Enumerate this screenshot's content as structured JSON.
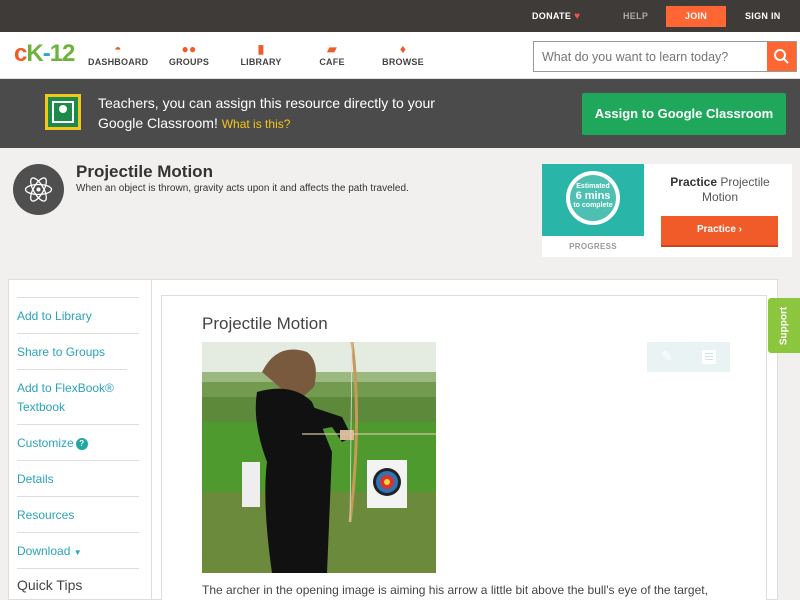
{
  "topbar": {
    "donate": "DONATE",
    "help": "HELP",
    "join": "JOIN",
    "signin": "SIGN IN"
  },
  "logo": {
    "c": "c",
    "k": "K",
    "dash": "-",
    "n": "12"
  },
  "nav": [
    {
      "label": "DASHBOARD",
      "icon": "dashboard-icon"
    },
    {
      "label": "GROUPS",
      "icon": "groups-icon"
    },
    {
      "label": "LIBRARY",
      "icon": "library-icon"
    },
    {
      "label": "CAFE",
      "icon": "cafe-icon"
    },
    {
      "label": "BROWSE",
      "icon": "browse-icon"
    }
  ],
  "search": {
    "placeholder": "What do you want to learn today?"
  },
  "banner": {
    "text_line": "Teachers, you can assign this resource directly to your Google Classroom!",
    "what_link": "What is this?",
    "assign_button": "Assign to Google Classroom"
  },
  "concept": {
    "title": "Projectile Motion",
    "subtitle": "When an object is thrown, gravity acts upon it and affects the path traveled."
  },
  "practice": {
    "estimated": "Estimated",
    "mins": "6 mins",
    "to_complete": "to complete",
    "progress_label": "PROGRESS",
    "title_bold": "Practice",
    "title_rest": "Projectile Motion",
    "button": "Practice"
  },
  "sidebar": {
    "items": [
      "Add to Library",
      "Share to Groups",
      "Add to FlexBook® Textbook",
      "Customize",
      "Details",
      "Resources",
      "Download"
    ],
    "quick_tips": "Quick Tips"
  },
  "article": {
    "title": "Projectile Motion",
    "body": "The archer in the opening image is aiming his arrow a little bit above the bull's eye of the target,"
  },
  "support": "Support",
  "colors": {
    "accent_orange": "#ff6633",
    "teal_link": "#29a3b9",
    "google_green": "#1fa85b",
    "support_green": "#8cc63f"
  }
}
